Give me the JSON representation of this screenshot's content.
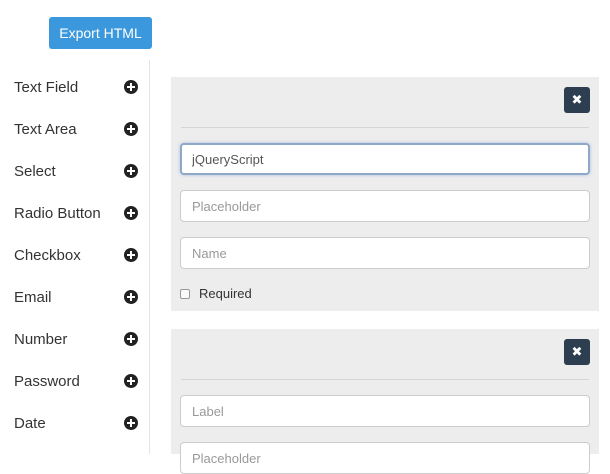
{
  "toolbar": {
    "export_label": "Export HTML"
  },
  "sidebar": {
    "items": [
      {
        "label": "Text Field"
      },
      {
        "label": "Text Area"
      },
      {
        "label": "Select"
      },
      {
        "label": "Radio Button"
      },
      {
        "label": "Checkbox"
      },
      {
        "label": "Email"
      },
      {
        "label": "Number"
      },
      {
        "label": "Password"
      },
      {
        "label": "Date"
      }
    ]
  },
  "panels": [
    {
      "close_icon": "✖",
      "label_value": "jQueryScript",
      "placeholder_placeholder": "Placeholder",
      "name_placeholder": "Name",
      "required_label": "Required"
    },
    {
      "close_icon": "✖",
      "label_placeholder": "Label",
      "placeholder_placeholder": "Placeholder"
    }
  ],
  "colors": {
    "accent": "#3b98dc",
    "close_bg": "#2c3e50",
    "panel_bg": "#ededed"
  }
}
